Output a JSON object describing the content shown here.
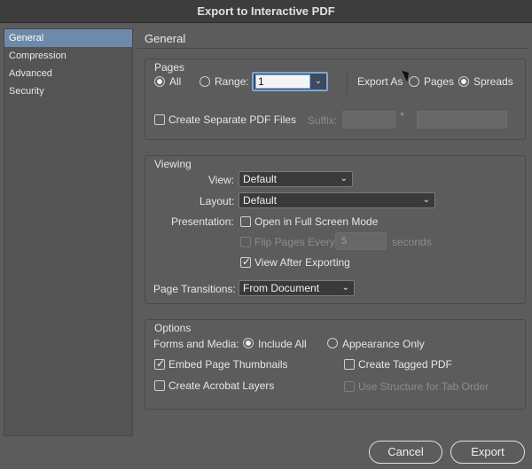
{
  "window": {
    "title": "Export to Interactive PDF"
  },
  "sidebar": {
    "items": [
      {
        "label": "General",
        "active": true
      },
      {
        "label": "Compression"
      },
      {
        "label": "Advanced"
      },
      {
        "label": "Security"
      }
    ]
  },
  "section_title": "General",
  "pages": {
    "title": "Pages",
    "all_label": "All",
    "range_label": "Range:",
    "range_value": "1",
    "export_as_label": "Export As",
    "pages_label": "Pages",
    "spreads_label": "Spreads",
    "create_separate_label": "Create Separate PDF Files",
    "suffix_label": "Suffix:"
  },
  "viewing": {
    "title": "Viewing",
    "view_label": "View:",
    "view_value": "Default",
    "layout_label": "Layout:",
    "layout_value": "Default",
    "presentation_label": "Presentation:",
    "full_screen_label": "Open in Full Screen Mode",
    "flip_label": "Flip Pages Every:",
    "flip_value": "5",
    "seconds_label": "seconds",
    "view_after_label": "View After Exporting",
    "transitions_label": "Page Transitions:",
    "transitions_value": "From Document"
  },
  "options": {
    "title": "Options",
    "forms_label": "Forms and Media:",
    "include_all_label": "Include All",
    "appearance_only_label": "Appearance Only",
    "embed_thumbs_label": "Embed Page Thumbnails",
    "tagged_pdf_label": "Create Tagged PDF",
    "acrobat_layers_label": "Create Acrobat Layers",
    "tab_order_label": "Use Structure for Tab Order"
  },
  "buttons": {
    "cancel": "Cancel",
    "export": "Export"
  }
}
